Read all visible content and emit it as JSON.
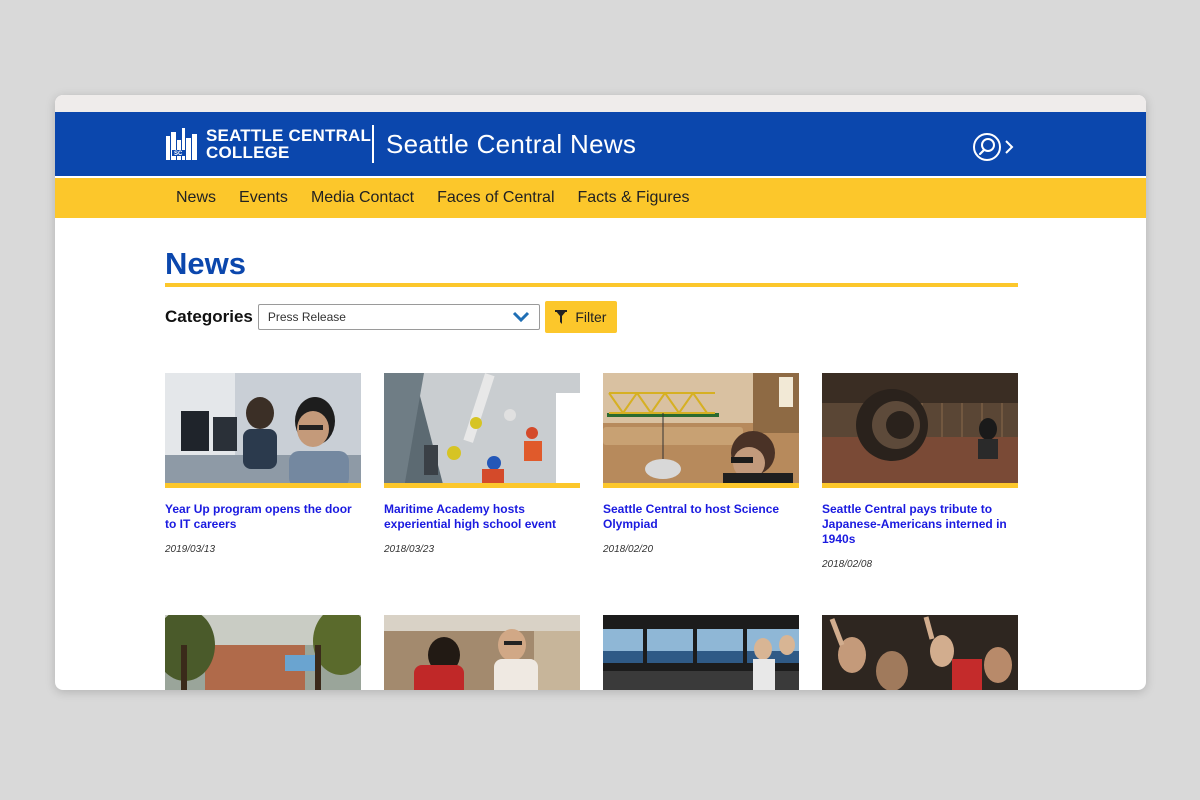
{
  "brand": {
    "logo_line1": "Seattle Central",
    "logo_line2": "College",
    "site_title": "Seattle Central News",
    "primary_color": "#0b47ad",
    "accent_color": "#fcc72b",
    "link_color": "#1a1ae0"
  },
  "header": {
    "search_icon": "search-chevron-icon"
  },
  "nav": {
    "items": [
      {
        "label": "News"
      },
      {
        "label": "Events"
      },
      {
        "label": "Media Contact"
      },
      {
        "label": "Faces of Central"
      },
      {
        "label": "Facts & Figures"
      }
    ]
  },
  "main": {
    "heading": "News",
    "categories_label": "Categories",
    "category_selected": "Press Release",
    "filter_label": "Filter",
    "filter_icon": "funnel-icon"
  },
  "articles": [
    {
      "title": "Year Up program opens the door to IT careers",
      "date": "2019/03/13"
    },
    {
      "title": "Maritime Academy hosts experiential high school event",
      "date": "2018/03/23"
    },
    {
      "title": "Seattle Central to host Science Olympiad",
      "date": "2018/02/20"
    },
    {
      "title": "Seattle Central pays tribute to Japanese-Americans interned in 1940s",
      "date": "2018/02/08"
    },
    {
      "title": "",
      "date": ""
    },
    {
      "title": "",
      "date": ""
    },
    {
      "title": "",
      "date": ""
    },
    {
      "title": "",
      "date": ""
    }
  ]
}
